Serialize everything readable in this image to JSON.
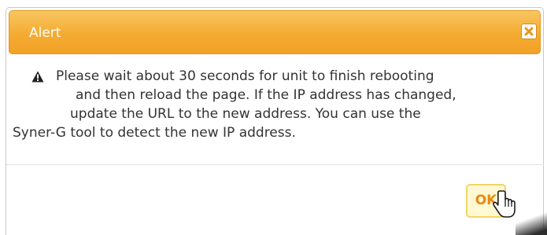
{
  "dialog": {
    "title": "Alert",
    "close_icon": "close-x-icon",
    "message_icon": "warning-triangle-icon",
    "message_lines": [
      "Please wait about 30 seconds for unit to finish rebooting",
      "and then reload the page. If the IP address has changed,",
      "update the URL to the new address. You can use the",
      "Syner-G tool to detect the new IP address."
    ],
    "ok_label": "OK",
    "cursor_icon": "hand-pointer-icon"
  },
  "colors": {
    "titlebar": "#f4ab31",
    "ok_text": "#e88a12",
    "ok_background": "#fff8d2"
  }
}
